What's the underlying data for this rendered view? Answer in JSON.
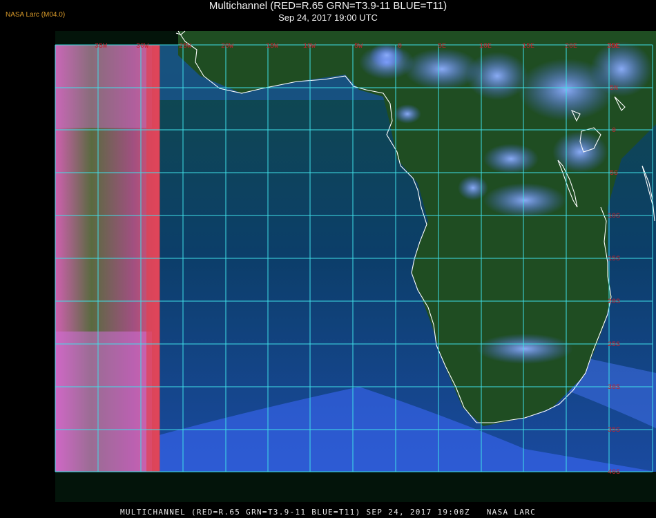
{
  "header": {
    "source": "NASA Larc (M04.0)",
    "title": "Multichannel (RED=R.65 GRN=T3.9-11 BLUE=T11)",
    "subtitle": "Sep 24, 2017 19:00 UTC"
  },
  "footer": {
    "text": "MULTICHANNEL (RED=R.65 GRN=T3.9-11 BLUE=T11) SEP 24, 2017 19:00Z   NASA LARC"
  },
  "map": {
    "longitude_labels": [
      "35W",
      "30W",
      "25W",
      "20W",
      "15W",
      "10W",
      "5W",
      "0",
      "5E",
      "10E",
      "15E",
      "20E",
      "25E",
      "30E",
      "35E"
    ],
    "latitude_labels": [
      "5N",
      "0",
      "5S",
      "10S",
      "15S",
      "20S",
      "25S",
      "30S",
      "35S",
      "40S"
    ],
    "grid_color": "#3fe0e8",
    "label_color": "#c8202a",
    "coast_color": "#ffffff",
    "ocean_color": "#0d3a6e",
    "land_color": "#1e5a2a",
    "cloud_color": "#6f8fff",
    "sun_glint_color": "#e070c0"
  }
}
